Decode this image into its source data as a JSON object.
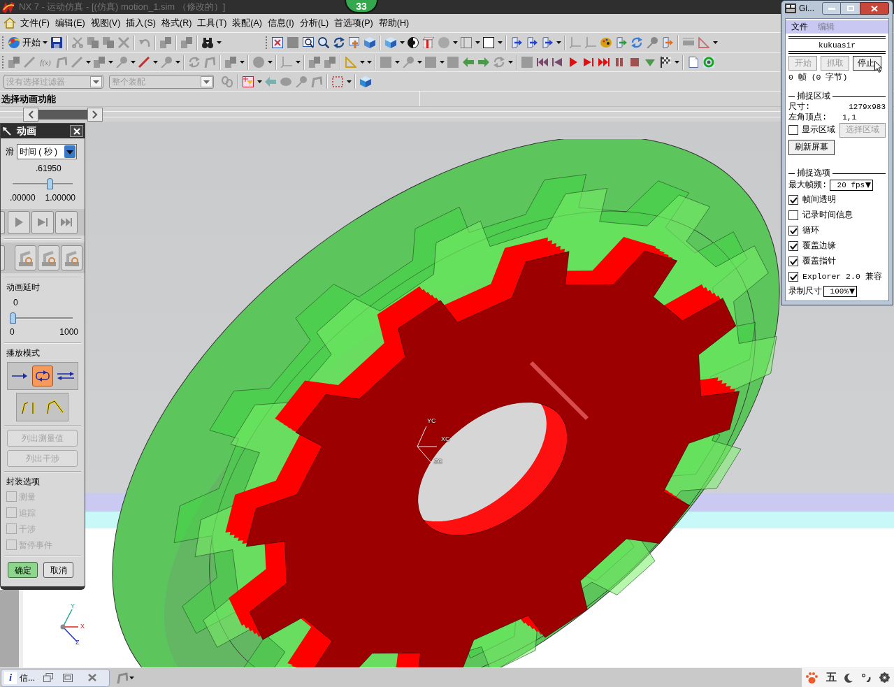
{
  "title_bar": {
    "title": "NX 7 - 运动仿真 - [(仿真) motion_1.sim （修改的）]",
    "badge": "33"
  },
  "menu_bar": [
    "文件(F)",
    "编辑(E)",
    "视图(V)",
    "插入(S)",
    "格式(R)",
    "工具(T)",
    "装配(A)",
    "信息(I)",
    "分析(L)",
    "首选项(P)",
    "帮助(H)"
  ],
  "toolbar": {
    "start_button": "开始",
    "expression_button": "f(x)"
  },
  "selection_bar": {
    "filter": "没有选择过滤器",
    "scope": "整个装配"
  },
  "prompt": "选择动画功能",
  "animation_dialog": {
    "title": "动画",
    "slider_label": "滑",
    "slider_type": "时间 ( 秒 )",
    "time": {
      "value": ".61950",
      "level": 0.6195,
      "min": ".00000",
      "max": "1.00000"
    },
    "delay_label": "动画延时",
    "delay": {
      "value": "0",
      "level": 0,
      "min": "0",
      "max": "1000"
    },
    "play_mode_label": "播放模式",
    "play_modes": [
      {
        "kind": "once",
        "selected": false
      },
      {
        "kind": "loop",
        "selected": true
      },
      {
        "kind": "back_and_forth",
        "selected": false
      }
    ],
    "list_buttons": [
      {
        "label": "列出测量值",
        "disabled": true
      },
      {
        "label": "列出干涉",
        "disabled": true
      }
    ],
    "package_label": "封装选项",
    "package_options": [
      {
        "label": "测量",
        "checked": false,
        "disabled": true
      },
      {
        "label": "追踪",
        "checked": false,
        "disabled": true
      },
      {
        "label": "干涉",
        "checked": false,
        "disabled": true
      },
      {
        "label": "暂停事件",
        "checked": false,
        "disabled": true
      }
    ],
    "ok_button": "确定",
    "cancel_button": "取消"
  },
  "viewport": {
    "wcs_axes": {
      "x": "XC",
      "y": "YC",
      "z": "ZC"
    },
    "view_triad": {
      "x": "X",
      "y": "Y",
      "z": "Z"
    }
  },
  "capture_window": {
    "title": "Gi...",
    "menu": [
      {
        "label": "文件",
        "disabled": false
      },
      {
        "label": "编辑",
        "disabled": true
      }
    ],
    "user": "kukuasir",
    "buttons": [
      {
        "label": "开始",
        "disabled": true
      },
      {
        "label": "抓取",
        "disabled": true
      },
      {
        "label": "停止",
        "disabled": false
      }
    ],
    "status": "0 帧 (0 字节)",
    "area": {
      "heading": "捕捉区域",
      "size_label": "尺寸:",
      "size": "1279x983",
      "origin_label": "左角顶点:",
      "origin": "1,1",
      "show_area": {
        "label": "显示区域",
        "checked": false
      },
      "select_button": {
        "label": "选择区域",
        "disabled": true
      },
      "refresh_button": "刷新屏幕"
    },
    "options": {
      "heading": "捕捉选项",
      "fps_label": "最大帧频:",
      "fps": "20 fps",
      "checkboxes": [
        {
          "label": "帧间透明",
          "checked": true
        },
        {
          "label": "记录时间信息",
          "checked": false
        },
        {
          "label": "循环",
          "checked": true
        },
        {
          "label": "覆盖边缘",
          "checked": true
        },
        {
          "label": "覆盖指针",
          "checked": true
        },
        {
          "label": "Explorer 2.0 兼容",
          "checked": true
        }
      ],
      "size_label": "录制尺寸",
      "size": "100%"
    }
  },
  "taskbar": {
    "info_badge": "i",
    "window_tab": "信...",
    "ime_mode": "五"
  }
}
